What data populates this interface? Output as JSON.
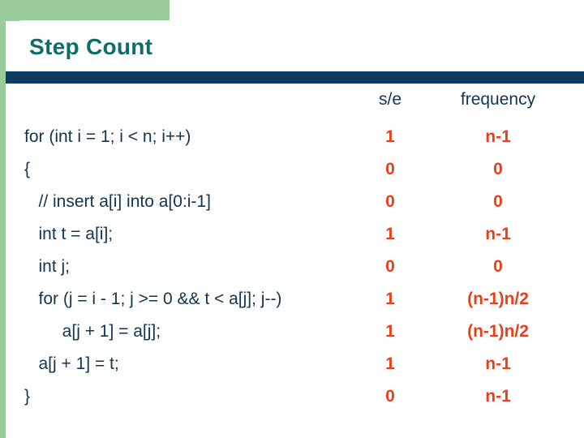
{
  "slide": {
    "title": "Step Count",
    "colors": {
      "accent_green": "#99cc99",
      "title_teal": "#0e6e66",
      "bar_navy": "#0d3b61",
      "code_navy": "#12354f",
      "value_orange": "#e8401c"
    }
  },
  "table": {
    "headers": {
      "code": "",
      "se": "s/e",
      "frequency": "frequency"
    },
    "rows": [
      {
        "code": "for (int i = 1; i < n; i++)",
        "se": "1",
        "frequency": "n-1"
      },
      {
        "code": "{",
        "se": "0",
        "frequency": "0"
      },
      {
        "code": "   // insert a[i] into a[0:i-1]",
        "se": "0",
        "frequency": "0"
      },
      {
        "code": "   int t = a[i];",
        "se": "1",
        "frequency": "n-1"
      },
      {
        "code": "   int j;",
        "se": "0",
        "frequency": "0"
      },
      {
        "code": "   for (j = i - 1; j >= 0 && t < a[j]; j--)",
        "se": "1",
        "frequency": "(n-1)n/2"
      },
      {
        "code": "        a[j + 1] = a[j];",
        "se": "1",
        "frequency": "(n-1)n/2"
      },
      {
        "code": "   a[j + 1] = t;",
        "se": "1",
        "frequency": "n-1"
      },
      {
        "code": "}",
        "se": "0",
        "frequency": "n-1"
      }
    ]
  }
}
